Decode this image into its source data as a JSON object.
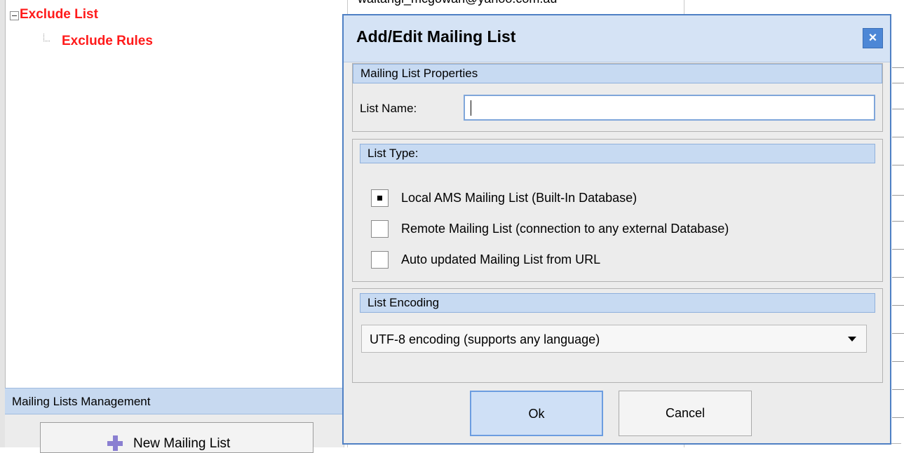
{
  "tree": {
    "item1": "Exclude List",
    "item2": "Exclude Rules"
  },
  "background": {
    "email_partial": "waitangi_mcgowan@yahoo.com.au"
  },
  "management": {
    "header": "Mailing Lists Management",
    "new_list_button": "New Mailing List"
  },
  "dialog": {
    "title": "Add/Edit Mailing List",
    "close_label": "×",
    "properties_header": "Mailing List Properties",
    "list_name_label": "List Name:",
    "list_name_value": "",
    "list_type_header": "List Type:",
    "list_types": [
      {
        "label": "Local AMS Mailing List (Built-In Database)",
        "checked": true
      },
      {
        "label": "Remote Mailing List (connection to any external Database)",
        "checked": false
      },
      {
        "label": "Auto updated Mailing List from URL",
        "checked": false
      }
    ],
    "encoding_header": "List Encoding",
    "encoding_value": "UTF-8 encoding (supports any language)",
    "ok_label": "Ok",
    "cancel_label": "Cancel"
  },
  "colors": {
    "tree_text": "#ff1a1a",
    "header_blue": "#c7daf2",
    "dialog_border": "#4f80c4",
    "close_button": "#4d87d6",
    "icon_plus": "#8a7fd1"
  }
}
